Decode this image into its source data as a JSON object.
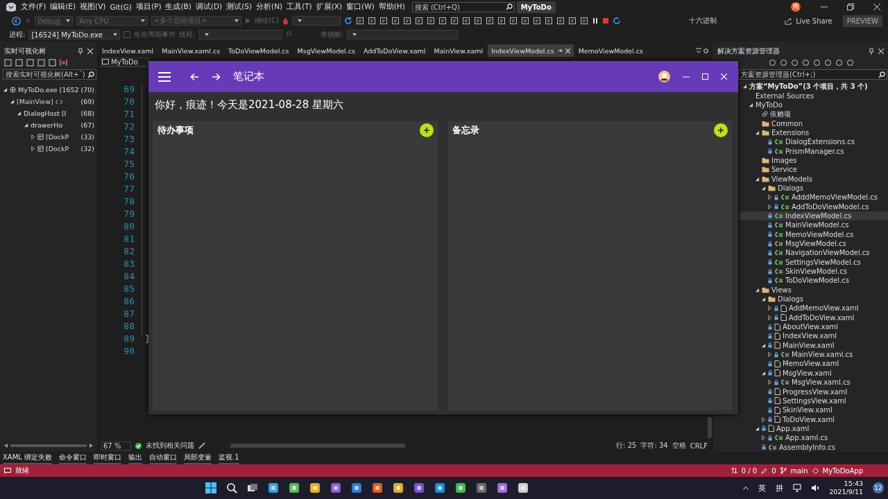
{
  "menu_bar": {
    "menus": [
      "文件(F)",
      "编辑(E)",
      "视图(V)",
      "Git(G)",
      "项目(P)",
      "生成(B)",
      "调试(D)",
      "测试(S)",
      "分析(N)",
      "工具(T)",
      "扩展(X)",
      "窗口(W)",
      "帮助(H)"
    ],
    "search": {
      "placeholder": "搜索 (Ctrl+Q)"
    },
    "solution_name": "MyToDo",
    "avatar": "周"
  },
  "toolbar": {
    "configuration": "Debug",
    "platform": "Any CPU",
    "startup": "<多个启动项目>",
    "continue": "继续(C)",
    "hex": "十六进制",
    "live_share": "Live Share",
    "preview": "PREVIEW"
  },
  "debug_location": {
    "process_label": "进程:",
    "process": "[16524] MyToDo.exe",
    "lifecycle": "生命周期事件",
    "thread_label": "线程:",
    "stack_label": "堆栈帧:"
  },
  "live_tree": {
    "title": "实时可视化树",
    "search": {
      "placeholder": "搜索实时可视化树(Alt+`)"
    },
    "items": [
      {
        "label": "MyToDo.exe [1652",
        "kind": "process",
        "count": "(70)",
        "expanded": true,
        "children": [
          {
            "label": "[MainView]",
            "kind": "view",
            "count": "(69)",
            "expanded": true,
            "children": [
              {
                "label": "DialogHost [I",
                "kind": "element",
                "count": "(68)",
                "expanded": true,
                "children": [
                  {
                    "label": "drawerHo",
                    "kind": "element",
                    "count": "(67)",
                    "expanded": true,
                    "children": [
                      {
                        "label": "[DockP",
                        "kind": "panel",
                        "count": "(33)",
                        "expanded": false
                      },
                      {
                        "label": "[DockP",
                        "kind": "panel",
                        "count": "(32)",
                        "expanded": false
                      }
                    ]
                  }
                ]
              }
            ]
          }
        ]
      }
    ]
  },
  "editor": {
    "tabs": [
      {
        "label": "IndexView.xaml",
        "selected": false
      },
      {
        "label": "MainView.xaml.cs",
        "selected": false
      },
      {
        "label": "ToDoViewModel.cs",
        "selected": false
      },
      {
        "label": "MsgViewModel.cs",
        "selected": false
      },
      {
        "label": "AddToDoView.xaml",
        "selected": false
      },
      {
        "label": "MainView.xaml",
        "selected": false
      },
      {
        "label": "IndexViewModel.cs",
        "selected": true
      },
      {
        "label": "MemoViewModel.cs",
        "selected": false
      }
    ],
    "nav": "MyToDo",
    "lines": [
      {
        "number": "69"
      },
      {
        "number": "70"
      },
      {
        "number": "71"
      },
      {
        "number": "72"
      },
      {
        "number": "73"
      },
      {
        "number": "74"
      },
      {
        "number": "75"
      },
      {
        "number": "76"
      },
      {
        "number": "77"
      },
      {
        "number": "78"
      },
      {
        "number": "79"
      },
      {
        "number": "80"
      },
      {
        "number": "81"
      },
      {
        "number": "82"
      },
      {
        "number": "83"
      },
      {
        "number": "84"
      },
      {
        "number": "85"
      },
      {
        "number": "86"
      },
      {
        "number": "87"
      },
      {
        "number": "88"
      },
      {
        "number": "89",
        "code": "}"
      },
      {
        "number": "90"
      }
    ],
    "zoom": "67 %",
    "issues": "未找到相关问题",
    "line": "行: 25",
    "char": "字符: 34",
    "spaces": "空格",
    "eol": "CRLF"
  },
  "app": {
    "title": "笔记本",
    "greeting": "你好，痕迹！今天是2021-08-28 星期六",
    "cards": [
      {
        "title": "待办事项"
      },
      {
        "title": "备忘录"
      }
    ]
  },
  "solution_explorer": {
    "title": "解决方案资源管理器",
    "search": {
      "placeholder": "方案资源管理器(Ctrl+;)"
    },
    "items": [
      {
        "label": "方案“MyToDo”(3 个项目，共 3 个)",
        "kind": "solution",
        "selected": false,
        "children": [
          {
            "label": "External Sources",
            "kind": "external",
            "selected": false
          },
          {
            "label": "MyToDo",
            "kind": "project",
            "selected": false,
            "children": [
              {
                "label": "依赖项",
                "kind": "deps",
                "selected": false
              },
              {
                "label": "Common",
                "kind": "folder",
                "selected": false
              },
              {
                "label": "Extensions",
                "kind": "folder",
                "selected": false,
                "children": [
                  {
                    "label": "DialogExtensions.cs",
                    "kind": "cs",
                    "selected": false
                  },
                  {
                    "label": "PrismManager.cs",
                    "kind": "cs",
                    "selected": false
                  }
                ]
              },
              {
                "label": "Images",
                "kind": "folder",
                "selected": false
              },
              {
                "label": "Service",
                "kind": "folder",
                "selected": false
              },
              {
                "label": "ViewModels",
                "kind": "folder",
                "selected": false,
                "children": [
                  {
                    "label": "Dialogs",
                    "kind": "folder",
                    "selected": false,
                    "children": [
                      {
                        "label": "AdddMemoViewModel.cs",
                        "kind": "cs",
                        "selected": false,
                        "expanded": false
                      },
                      {
                        "label": "AddToDoViewModel.cs",
                        "kind": "cs",
                        "selected": false,
                        "expanded": false
                      }
                    ]
                  },
                  {
                    "label": "IndexViewModel.cs",
                    "kind": "cs",
                    "selected": true
                  },
                  {
                    "label": "MainViewModel.cs",
                    "kind": "cs",
                    "selected": false
                  },
                  {
                    "label": "MemoViewModel.cs",
                    "kind": "cs",
                    "selected": false
                  },
                  {
                    "label": "MsgViewModel.cs",
                    "kind": "cs",
                    "selected": false
                  },
                  {
                    "label": "NavigationViewModel.cs",
                    "kind": "cs",
                    "selected": false
                  },
                  {
                    "label": "SettingsViewModel.cs",
                    "kind": "cs",
                    "selected": false
                  },
                  {
                    "label": "SkinViewModel.cs",
                    "kind": "cs",
                    "selected": false
                  },
                  {
                    "label": "ToDoViewModel.cs",
                    "kind": "cs",
                    "selected": false
                  }
                ]
              },
              {
                "label": "Views",
                "kind": "folder",
                "selected": false,
                "children": [
                  {
                    "label": "Dialogs",
                    "kind": "folder",
                    "selected": false,
                    "children": [
                      {
                        "label": "AddMemoView.xaml",
                        "kind": "xaml",
                        "selected": false,
                        "expanded": false
                      },
                      {
                        "label": "AddToDoView.xaml",
                        "kind": "xaml",
                        "selected": false,
                        "expanded": false
                      }
                    ]
                  },
                  {
                    "label": "AboutView.xaml",
                    "kind": "xaml",
                    "selected": false
                  },
                  {
                    "label": "IndexView.xaml",
                    "kind": "xaml",
                    "selected": false
                  },
                  {
                    "label": "MainView.xaml",
                    "kind": "xaml",
                    "selected": false,
                    "children": [
                      {
                        "label": "MainView.xaml.cs",
                        "kind": "cs",
                        "selected": false,
                        "expanded": false
                      }
                    ]
                  },
                  {
                    "label": "MemoView.xaml",
                    "kind": "xaml",
                    "selected": false
                  },
                  {
                    "label": "MsgView.xaml",
                    "kind": "xaml",
                    "selected": false,
                    "children": [
                      {
                        "label": "MsgView.xaml.cs",
                        "kind": "cs",
                        "selected": false,
                        "expanded": false
                      }
                    ]
                  },
                  {
                    "label": "ProgressView.xaml",
                    "kind": "xaml",
                    "selected": false
                  },
                  {
                    "label": "SettingsView.xaml",
                    "kind": "xaml",
                    "selected": false
                  },
                  {
                    "label": "SkinView.xaml",
                    "kind": "xaml",
                    "selected": false
                  },
                  {
                    "label": "ToDoView.xaml",
                    "kind": "xaml",
                    "selected": false,
                    "expanded": false
                  }
                ]
              },
              {
                "label": "App.xaml",
                "kind": "xaml",
                "selected": false,
                "children": [
                  {
                    "label": "App.xaml.cs",
                    "kind": "cs",
                    "selected": false,
                    "expanded": false
                  }
                ]
              },
              {
                "label": "AssemblyInfo.cs",
                "kind": "cs",
                "selected": false
              }
            ]
          }
        ]
      }
    ]
  },
  "tool_tabs": [
    "XAML 绑定失败",
    "命令窗口",
    "即时窗口",
    "输出",
    "自动窗口",
    "局部变量",
    "监视 1"
  ],
  "status_bar": {
    "message": "就绪",
    "changes": "0 / 0",
    "edits": "0",
    "branch": "main",
    "repo": "MyToDoApp"
  },
  "taskbar": {
    "ime": "英",
    "ime_mode": "拼",
    "time": "15:43",
    "date": "2021/9/11",
    "notifications": "12"
  }
}
